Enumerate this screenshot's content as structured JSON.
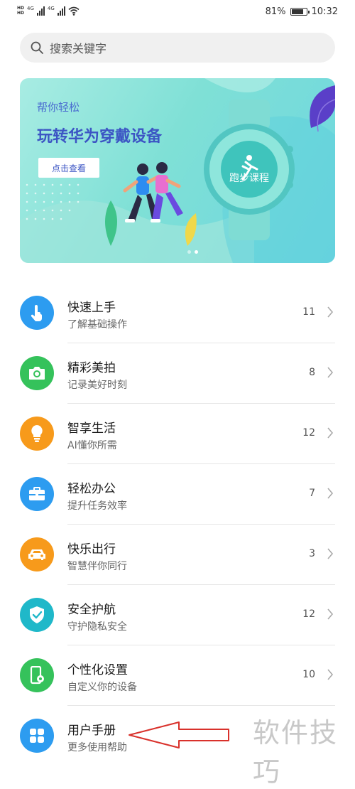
{
  "status": {
    "net1": "4G",
    "net2": "4G",
    "battery": "81%",
    "battery_level": 0.81,
    "time": "10:32"
  },
  "search": {
    "placeholder": "搜索关键字"
  },
  "banner": {
    "subtitle": "帮你轻松",
    "title": "玩转华为穿戴设备",
    "button_label": "点击查看",
    "watch_label": "跑步课程",
    "page_count": 2,
    "active_page": 1
  },
  "items": [
    {
      "title": "快速上手",
      "subtitle": "了解基础操作",
      "count": "11",
      "icon": "touch-hand-icon",
      "color": "#2d9cf0"
    },
    {
      "title": "精彩美拍",
      "subtitle": "记录美好时刻",
      "count": "8",
      "icon": "camera-icon",
      "color": "#35c25b"
    },
    {
      "title": "智享生活",
      "subtitle": "AI懂你所需",
      "count": "12",
      "icon": "lightbulb-icon",
      "color": "#f79a1b"
    },
    {
      "title": "轻松办公",
      "subtitle": "提升任务效率",
      "count": "7",
      "icon": "briefcase-icon",
      "color": "#2d9cf0"
    },
    {
      "title": "快乐出行",
      "subtitle": "智慧伴你同行",
      "count": "3",
      "icon": "car-icon",
      "color": "#f79a1b"
    },
    {
      "title": "安全护航",
      "subtitle": "守护隐私安全",
      "count": "12",
      "icon": "shield-check-icon",
      "color": "#1fb8c9"
    },
    {
      "title": "个性化设置",
      "subtitle": "自定义你的设备",
      "count": "10",
      "icon": "phone-settings-icon",
      "color": "#35c25b"
    },
    {
      "title": "用户手册",
      "subtitle": "更多使用帮助",
      "count": "",
      "icon": "grid-icon",
      "color": "#2d9cf0"
    }
  ],
  "watermark": "软件技巧"
}
